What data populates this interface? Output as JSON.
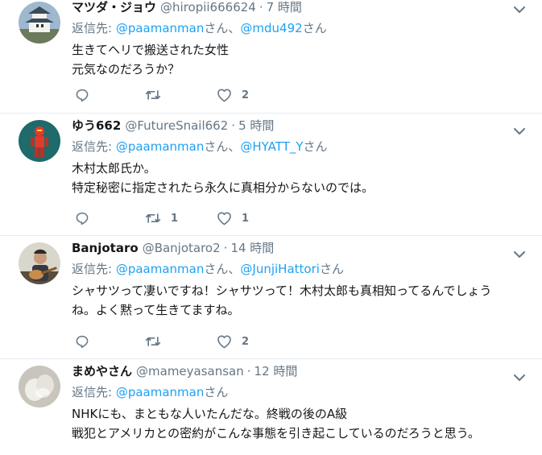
{
  "reply_prefix": "返信先:",
  "san_suffix": "さん",
  "separator": "、",
  "dot": "·",
  "tweets": [
    {
      "display_name": "マツダ・ジョウ",
      "handle": "@hiropii666624",
      "time": "7 時間",
      "reply_to": [
        "@paamanman",
        "@mdu492"
      ],
      "text": "生きてヘリで搬送された女性\n元気なのだろうか？",
      "counts": {
        "replies": "",
        "retweets": "",
        "likes": "2"
      }
    },
    {
      "display_name": "ゆう662",
      "handle": "@FutureSnail662",
      "time": "5 時間",
      "reply_to": [
        "@paamanman",
        "@HYATT_Y"
      ],
      "text": "木村太郎氏か。\n特定秘密に指定されたら永久に真相分からないのでは。",
      "counts": {
        "replies": "",
        "retweets": "1",
        "likes": "1"
      }
    },
    {
      "display_name": "Banjotaro",
      "handle": "@Banjotaro2",
      "time": "14 時間",
      "reply_to": [
        "@paamanman",
        "@JunjiHattori"
      ],
      "text": "シャサツって凄いですね！シャサツって！木村太郎も真相知ってるんでしょう\nね。よく黙って生きてますね。",
      "counts": {
        "replies": "",
        "retweets": "",
        "likes": "2"
      }
    },
    {
      "display_name": "まめやさん",
      "handle": "@mameyasansan",
      "time": "12 時間",
      "reply_to": [
        "@paamanman"
      ],
      "text": "NHKにも、まともな人いたんだな。終戦の後のA級\n戦犯とアメリカとの密約がこんな事態を引き起こしているのだろうと思う。",
      "counts": {
        "replies": "",
        "retweets": "",
        "likes": ""
      }
    }
  ],
  "colors": {
    "link": "#1da1f2",
    "secondary": "#657786",
    "divider": "#e6ecf0",
    "text": "#14171a"
  },
  "icons": [
    "caret-down-icon",
    "reply-icon",
    "retweet-icon",
    "like-icon"
  ]
}
